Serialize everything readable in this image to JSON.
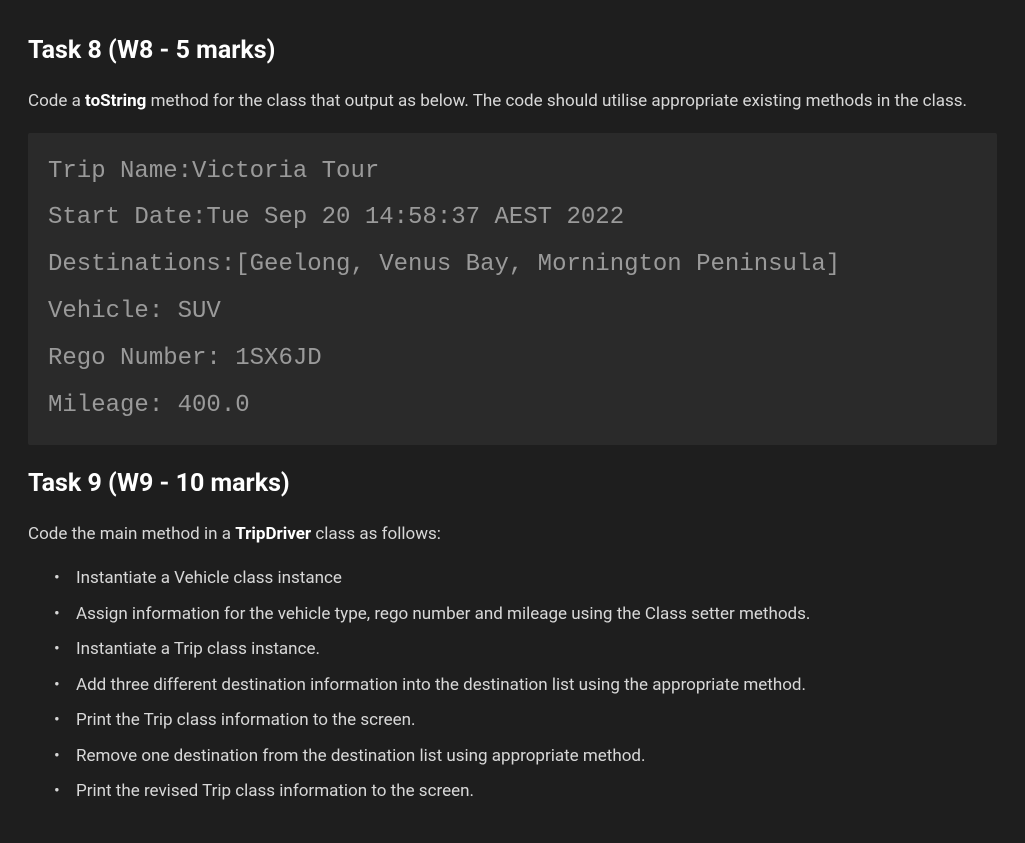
{
  "task8": {
    "heading": "Task 8 (W8 - 5 marks)",
    "intro_prefix": "Code a ",
    "intro_bold": "toString",
    "intro_suffix": " method for the class that output as below. The code should utilise appropriate existing methods in the class.",
    "code_output": "Trip Name:Victoria Tour\nStart Date:Tue Sep 20 14:58:37 AEST 2022\nDestinations:[Geelong, Venus Bay, Mornington Peninsula]\nVehicle: SUV\nRego Number: 1SX6JD\nMileage: 400.0"
  },
  "task9": {
    "heading": "Task 9 (W9 - 10 marks)",
    "intro_prefix": "Code the main method in a ",
    "intro_bold": "TripDriver",
    "intro_suffix": " class as follows:",
    "bullets": [
      "Instantiate a Vehicle class instance",
      "Assign information for the vehicle type, rego number and mileage using the Class setter methods.",
      "Instantiate a Trip class instance.",
      "Add three different destination information into the destination list using the appropriate method.",
      "Print the Trip class information to the screen.",
      "Remove one destination from the destination list using appropriate method.",
      "Print the revised Trip class information to the screen."
    ]
  }
}
